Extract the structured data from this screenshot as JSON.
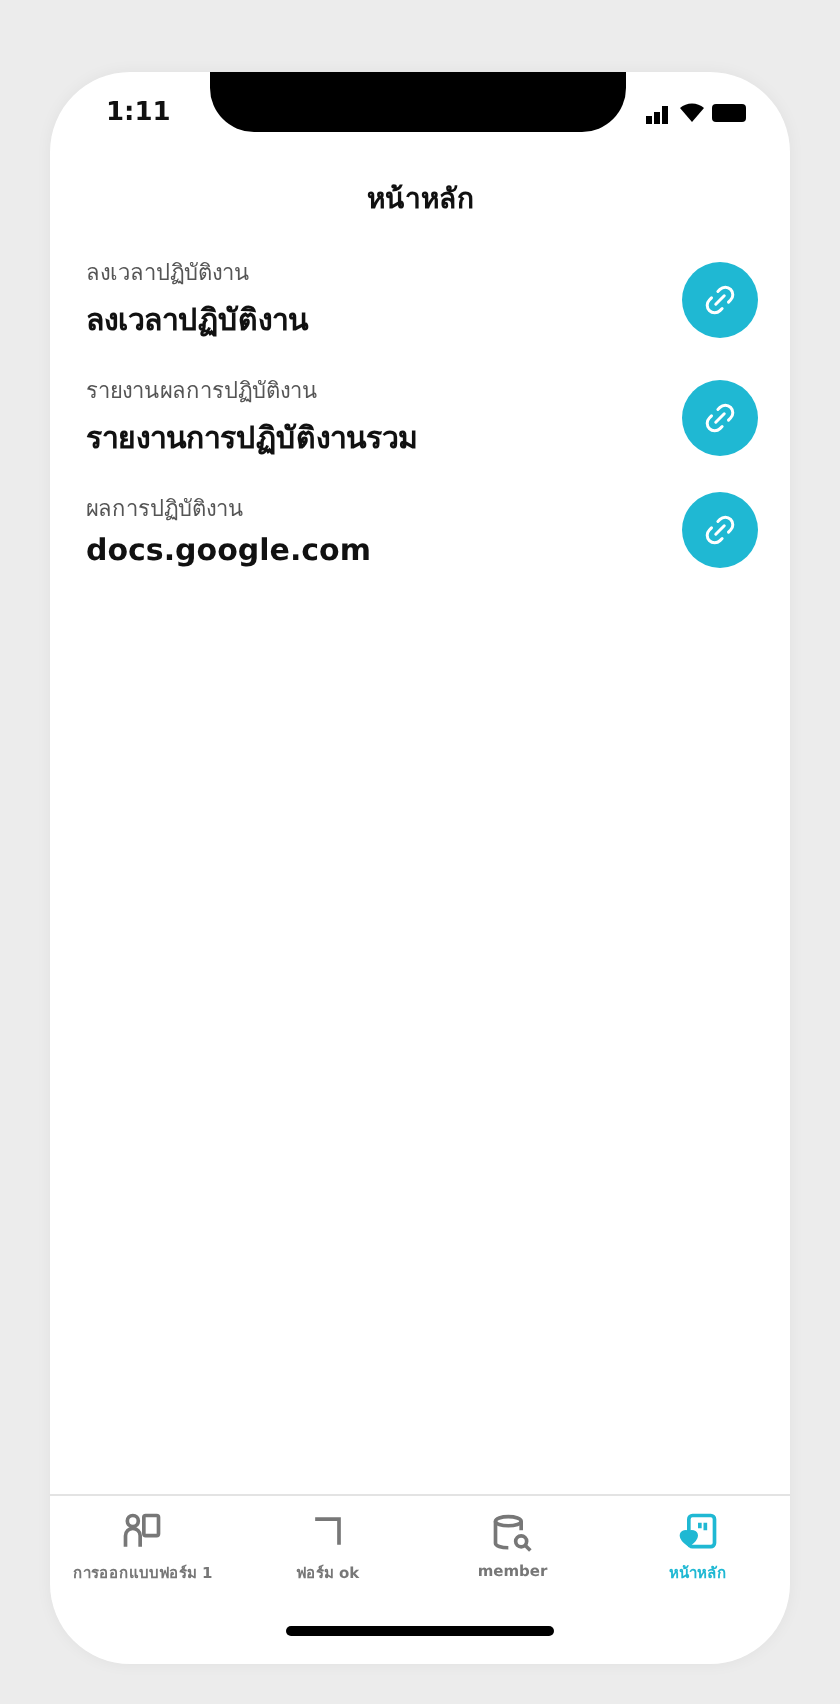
{
  "status_bar": {
    "time": "1:11"
  },
  "header": {
    "title": "หน้าหลัก"
  },
  "links": [
    {
      "caption": "ลงเวลาปฏิบัติงาน",
      "title": "ลงเวลาปฏิบัติงาน"
    },
    {
      "caption": "รายงานผลการปฏิบัติงาน",
      "title": "รายงานการปฏิบัติงานรวม"
    },
    {
      "caption": "ผลการปฏิบัติงาน",
      "title": "docs.google.com"
    }
  ],
  "tabs": [
    {
      "label": "การออกแบบฟอร์ม 1",
      "kind": "people",
      "selected": false
    },
    {
      "label": "ฟอร์ม ok",
      "kind": "corner",
      "selected": false
    },
    {
      "label": "member",
      "kind": "database",
      "selected": false
    },
    {
      "label": "หน้าหลัก",
      "kind": "home",
      "selected": true
    }
  ]
}
